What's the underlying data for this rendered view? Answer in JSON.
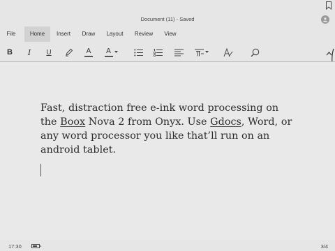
{
  "window": {
    "title": "Document (11) - Saved"
  },
  "menu": {
    "tabs": [
      {
        "label": "File"
      },
      {
        "label": "Home"
      },
      {
        "label": "Insert"
      },
      {
        "label": "Draw"
      },
      {
        "label": "Layout"
      },
      {
        "label": "Review"
      },
      {
        "label": "View"
      }
    ],
    "active_tab": "Home"
  },
  "toolbar": {
    "bold_label": "B",
    "italic_label": "I",
    "underline_label": "U",
    "font_color_label": "A",
    "highlight_color": "#555555"
  },
  "document": {
    "paragraph": [
      {
        "text": "Fast, distraction free e-ink word processing on the "
      },
      {
        "text": "Boox",
        "flagged": true
      },
      {
        "text": " Nova 2 from Onyx. Use "
      },
      {
        "text": "Gdocs",
        "flagged": true
      },
      {
        "text": ", Word, or any word processor you like that’ll run on an android tablet."
      }
    ]
  },
  "status": {
    "time": "17:30",
    "battery_level": 0.7,
    "page_count": "3/4"
  }
}
